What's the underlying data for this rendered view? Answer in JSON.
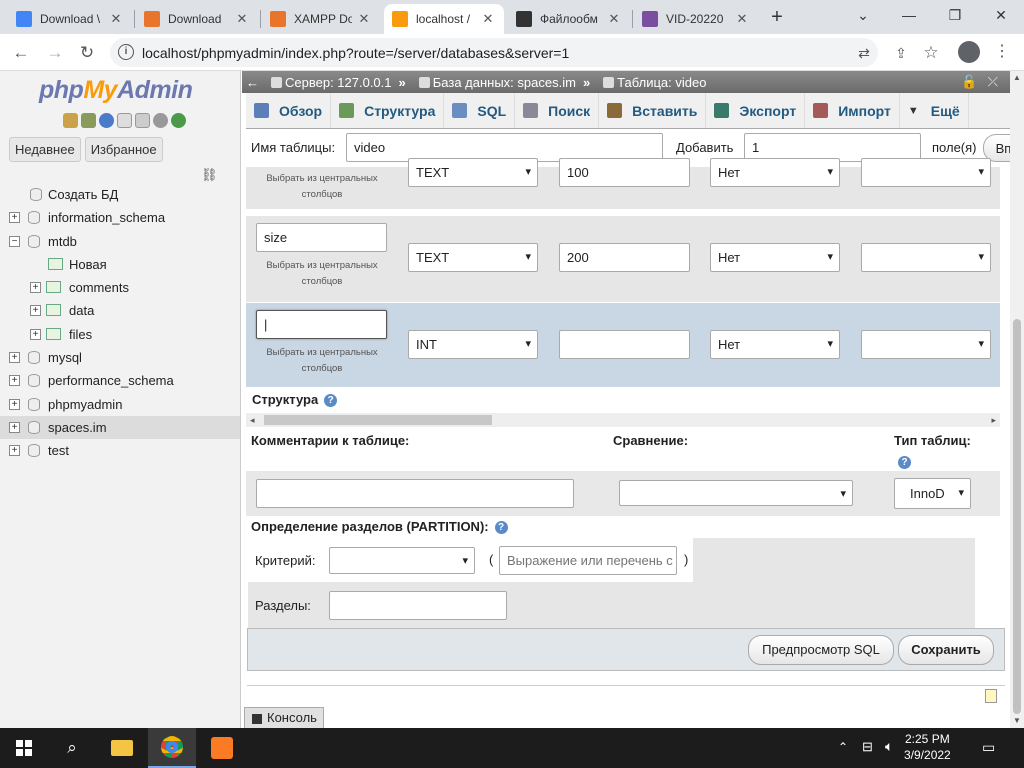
{
  "browser": {
    "tabs": [
      {
        "title": "Download \\",
        "icon_color": "#4285f4",
        "active": false
      },
      {
        "title": "Download",
        "icon_color": "#e8752b",
        "active": false
      },
      {
        "title": "XAMPP Do",
        "icon_color": "#e8752b",
        "active": false
      },
      {
        "title": "localhost /",
        "icon_color": "#f89c0e",
        "active": true
      },
      {
        "title": "Файлообм",
        "icon_color": "#333333",
        "active": false
      },
      {
        "title": "VID-20220",
        "icon_color": "#7b4fa0",
        "active": false
      }
    ],
    "new_tab": "+",
    "url": "localhost/phpmyadmin/index.php?route=/server/databases&server=1",
    "win_min": "⌄",
    "win_minimize": "—",
    "win_restore": "❐",
    "win_close": "✕"
  },
  "sidebar": {
    "logo": {
      "php": "php",
      "my": "My",
      "admin": "Admin"
    },
    "tab_recent": "Недавнее",
    "tab_favorites": "Избранное",
    "tree": [
      {
        "label": "Создать БД",
        "level": 1,
        "type": "new"
      },
      {
        "label": "information_schema",
        "level": 0,
        "type": "db",
        "expander": "+"
      },
      {
        "label": "mtdb",
        "level": 0,
        "type": "db",
        "expander": "−"
      },
      {
        "label": "Новая",
        "level": 2,
        "type": "new-table"
      },
      {
        "label": "comments",
        "level": 1,
        "type": "table",
        "expander": "+"
      },
      {
        "label": "data",
        "level": 1,
        "type": "table",
        "expander": "+"
      },
      {
        "label": "files",
        "level": 1,
        "type": "table",
        "expander": "+"
      },
      {
        "label": "mysql",
        "level": 0,
        "type": "db",
        "expander": "+"
      },
      {
        "label": "performance_schema",
        "level": 0,
        "type": "db",
        "expander": "+"
      },
      {
        "label": "phpmyadmin",
        "level": 0,
        "type": "db",
        "expander": "+"
      },
      {
        "label": "spaces.im",
        "level": 0,
        "type": "db",
        "expander": "+",
        "selected": true
      },
      {
        "label": "test",
        "level": 0,
        "type": "db",
        "expander": "+"
      }
    ]
  },
  "breadcrumb": {
    "server": "Сервер: 127.0.0.1",
    "database": "База данных: spaces.im",
    "table": "Таблица: video",
    "sep": "»"
  },
  "menu_tabs": [
    "Обзор",
    "Структура",
    "SQL",
    "Поиск",
    "Вставить",
    "Экспорт",
    "Импорт",
    "Ещё"
  ],
  "form": {
    "table_name_label": "Имя таблицы:",
    "table_name_value": "video",
    "add_label": "Добавить",
    "add_value": "1",
    "fields_label": "поле(я)",
    "go_button": "Вп",
    "central_columns_line1": "Выбрать из центральных",
    "central_columns_line2": "столбцов",
    "rows": [
      {
        "name": "",
        "type": "TEXT",
        "length": "100",
        "default": "Нет",
        "collation": ""
      },
      {
        "name": "size",
        "type": "TEXT",
        "length": "200",
        "default": "Нет",
        "collation": ""
      },
      {
        "name": "",
        "type": "INT",
        "length": "",
        "default": "Нет",
        "collation": ""
      }
    ],
    "structure_label": "Структура",
    "table_comments_label": "Комментарии к таблице:",
    "collation_label": "Сравнение:",
    "table_type_label": "Тип таблиц:",
    "table_type_value": "InnoD",
    "partition_label": "Определение разделов (PARTITION):",
    "criterion_label": "Критерий:",
    "expression_placeholder": "Выражение или перечень с",
    "paren_open": "(",
    "paren_close": ")",
    "partitions_label": "Разделы:",
    "preview_sql_button": "Предпросмотр SQL",
    "save_button": "Сохранить",
    "console_label": "Консоль"
  },
  "taskbar": {
    "time": "2:25 PM",
    "date": "3/9/2022"
  }
}
